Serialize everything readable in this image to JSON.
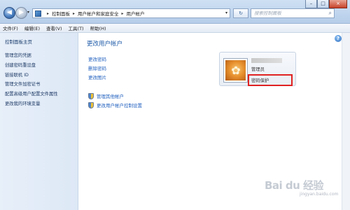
{
  "window": {
    "minimize_glyph": "–",
    "maximize_glyph": "□",
    "close_glyph": "×"
  },
  "nav": {
    "back_glyph": "◀",
    "forward_glyph": "▶",
    "recent_glyph": "▾",
    "refresh_glyph": "↻"
  },
  "address": {
    "separator": "▸",
    "crumbs": [
      "控制面板",
      "用户帐户和家庭安全",
      "用户帐户"
    ],
    "dropdown_glyph": "▾"
  },
  "search": {
    "placeholder": "搜索控制面板",
    "icon": "search-icon"
  },
  "menu": [
    "文件(F)",
    "编辑(E)",
    "查看(V)",
    "工具(T)",
    "帮助(H)"
  ],
  "sidebar": {
    "home": "控制面板主页",
    "links": [
      "管理您的凭据",
      "创建密码重设盘",
      "链接联机 ID",
      "管理文件加密证书",
      "配置高级用户配置文件属性",
      "更改我的环境变量"
    ]
  },
  "main": {
    "title": "更改用户帐户",
    "tasks": [
      "更改密码",
      "删除密码",
      "更改图片"
    ],
    "shield_links": [
      "管理其他帐户",
      "更改用户帐户控制设置"
    ]
  },
  "account": {
    "name": "",
    "role": "管理员",
    "password_status": "密码保护"
  },
  "help_glyph": "?",
  "watermark": {
    "text": "Bai du 经验",
    "sub": "jingyan.baidu.com"
  },
  "colors": {
    "link": "#1f5fbf",
    "title": "#1d5aa8",
    "highlight_box": "#e02222"
  }
}
